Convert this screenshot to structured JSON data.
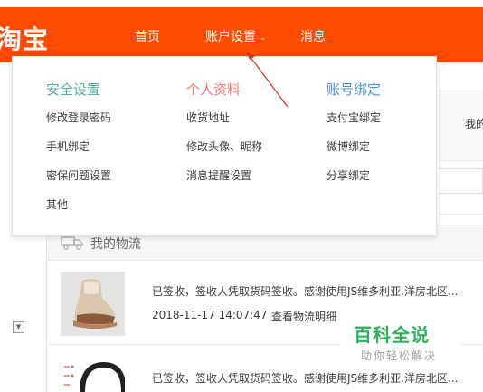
{
  "nav": {
    "logo": "淘宝",
    "home": "首页",
    "account_settings": "账户设置",
    "account_caret": "⌄",
    "messages": "消息"
  },
  "dropdown": {
    "columns": [
      {
        "title": "安全设置",
        "links": [
          "修改登录密码",
          "手机绑定",
          "密保问题设置",
          "其他"
        ]
      },
      {
        "title": "个人资料",
        "links": [
          "收货地址",
          "修改头像、昵称",
          "消息提醒设置"
        ]
      },
      {
        "title": "账号绑定",
        "links": [
          "支付宝绑定",
          "微博绑定",
          "分享绑定"
        ]
      }
    ]
  },
  "right_strip": {
    "text": "我的"
  },
  "logistics": {
    "title": "我的物流",
    "items": [
      {
        "status": "已签收，签收人凭取货码签收。感谢使用JS维多利亚.洋房北区...",
        "time": "2018-11-17 14:07:47",
        "link": "查看物流明细"
      },
      {
        "status": "已签收，签收人凭取货码签收。感谢使用JS维多利亚.洋房北区..."
      }
    ]
  },
  "watermark": {
    "title": "百科全说",
    "subtitle": "助你轻松解决"
  },
  "colors": {
    "nav_bg": "#ff4a00",
    "security": "#5aa8a2",
    "profile": "#f07b6f",
    "binding": "#4d90c9",
    "arrow": "#c0392b",
    "watermark": "#2fb05a"
  }
}
